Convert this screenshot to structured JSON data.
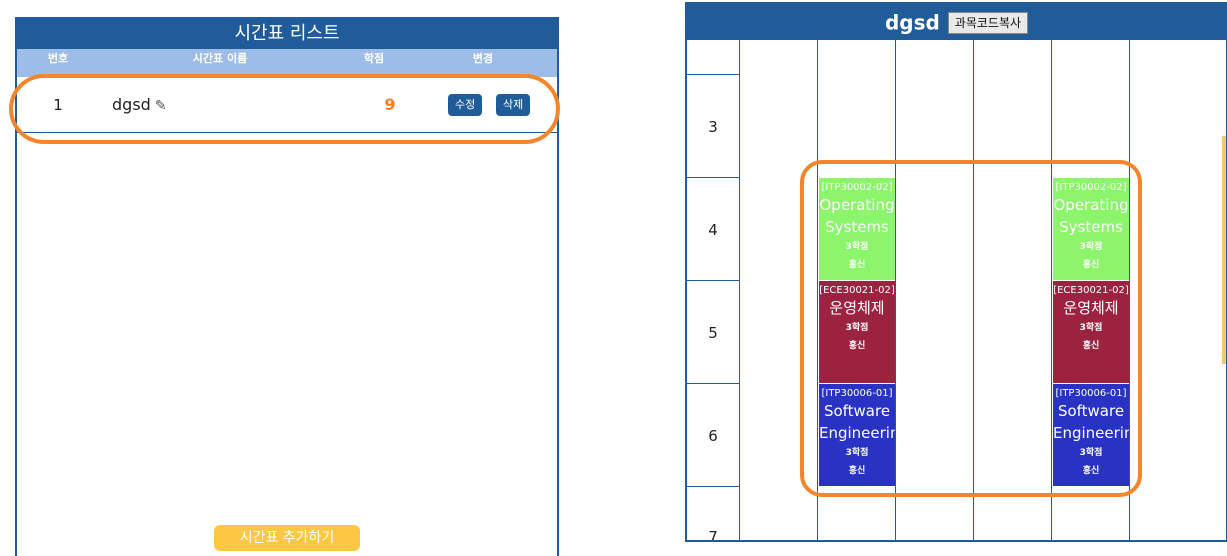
{
  "list_panel": {
    "title": "시간표 리스트",
    "headers": {
      "no": "번호",
      "name": "시간표 이름",
      "credit": "학점",
      "change": "변경"
    },
    "rows": [
      {
        "no": "1",
        "name": "dgsd",
        "credit": "9",
        "edit_label": "수정",
        "delete_label": "삭제"
      }
    ],
    "add_label": "시간표 추가하기",
    "pencil_icon": "✎"
  },
  "timetable": {
    "name": "dgsd",
    "copy_label": "과목코드복사",
    "periods": [
      "3",
      "4",
      "5",
      "6",
      "7"
    ],
    "courses": [
      {
        "code": "[ITP30002-02]",
        "title": "Operating Systems",
        "line1": "Operating",
        "line2": "Systems",
        "credit": "3학점",
        "prof": "홍신",
        "color": "#8cf56c"
      },
      {
        "code": "[ECE30021-02]",
        "title": "운영체제",
        "line1": "운영체제",
        "line2": "",
        "credit": "3학점",
        "prof": "홍신",
        "color": "#9c2340"
      },
      {
        "code": "[ITP30006-01]",
        "title": "Software Engineering",
        "line1": "Software",
        "line2": "Engineerin",
        "credit": "3학점",
        "prof": "홍신",
        "color": "#2833c4"
      }
    ]
  },
  "colors": {
    "primary": "#1f5c99",
    "header_light": "#9dbde8",
    "accent_orange": "#f5852a",
    "add_button": "#fcc743"
  }
}
